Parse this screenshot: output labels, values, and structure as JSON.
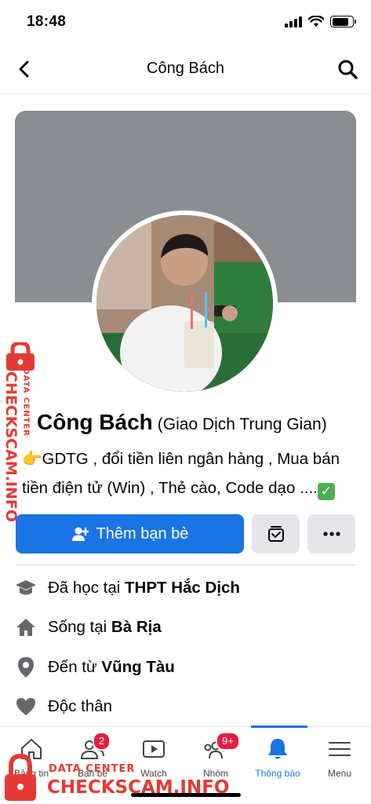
{
  "status_bar": {
    "time": "18:48"
  },
  "header": {
    "title": "Công Bách"
  },
  "profile": {
    "name": "Công Bách",
    "alt_name": "(Giao Dịch Trung Gian)",
    "bio_emoji": "👉",
    "bio_text": "GDTG , đổi tiền liên ngân hàng , Mua bán tiền điện tử (Win) , Thẻ cào, Code dạo ....",
    "bio_check": "✓"
  },
  "actions": {
    "add_friend_label": "Thêm bạn bè"
  },
  "info": [
    {
      "icon": "education-cap-icon",
      "prefix": "Đã học tại ",
      "value": "THPT Hắc Dịch"
    },
    {
      "icon": "home-icon",
      "prefix": "Sống tại ",
      "value": "Bà Rịa"
    },
    {
      "icon": "location-pin-icon",
      "prefix": "Đến từ ",
      "value": "Vũng Tàu"
    },
    {
      "icon": "heart-icon",
      "prefix": "Độc thân",
      "value": ""
    }
  ],
  "tabs": [
    {
      "label": "Bảng tin",
      "icon": "home-icon"
    },
    {
      "label": "Bạn bè",
      "icon": "friends-icon",
      "badge": "2"
    },
    {
      "label": "Watch",
      "icon": "watch-icon"
    },
    {
      "label": "Nhóm",
      "icon": "groups-icon",
      "badge": "9+"
    },
    {
      "label": "Thông báo",
      "icon": "bell-icon",
      "active": true
    },
    {
      "label": "Menu",
      "icon": "menu-icon"
    }
  ],
  "watermark": {
    "brand": "CHECKSCAM.INFO",
    "sub": "DATA CENTER"
  },
  "colors": {
    "accent": "#1b74e4",
    "badge": "#e41e3f",
    "watermark": "#e53935",
    "cover": "#8a8d91"
  }
}
